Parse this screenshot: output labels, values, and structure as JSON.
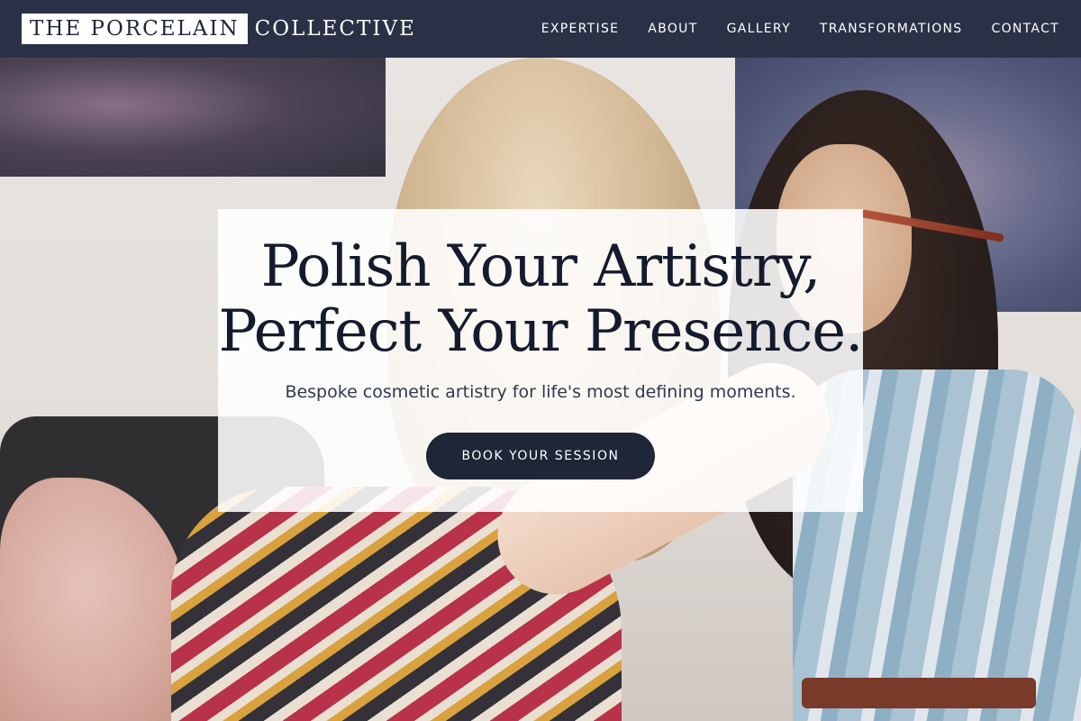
{
  "brand": {
    "name_boxed": "THE PORCELAIN",
    "name_plain": "COLLECTIVE"
  },
  "nav": {
    "items": [
      {
        "label": "EXPERTISE"
      },
      {
        "label": "ABOUT"
      },
      {
        "label": "GALLERY"
      },
      {
        "label": "TRANSFORMATIONS"
      },
      {
        "label": "CONTACT"
      }
    ]
  },
  "hero": {
    "title_line1": "Polish Your Artistry,",
    "title_line2": "Perfect Your Presence.",
    "subtitle": "Bespoke cosmetic artistry for life's most defining moments.",
    "cta_label": "BOOK YOUR SESSION",
    "image_description": "Makeup artist applying eye makeup to a client"
  },
  "colors": {
    "navbar": "#2a3146",
    "ink": "#141b2e",
    "button": "#1e2638",
    "card": "#ffffff"
  }
}
